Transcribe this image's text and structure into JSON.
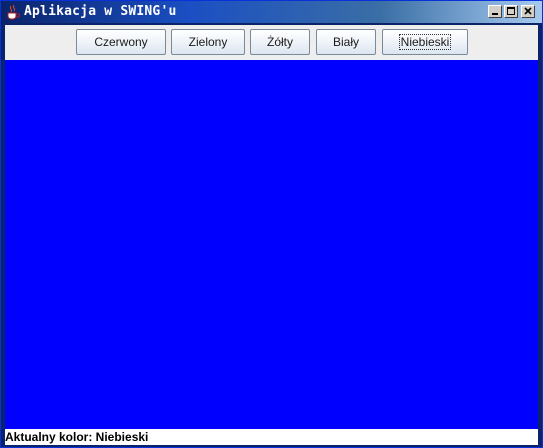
{
  "window": {
    "title": "Aplikacja w SWING'u",
    "icons": {
      "app": "java-coffee-cup-icon",
      "minimize": "minimize-icon",
      "maximize": "maximize-icon",
      "close": "close-icon"
    }
  },
  "toolbar": {
    "buttons": [
      {
        "id": "red",
        "label": "Czerwony"
      },
      {
        "id": "green",
        "label": "Zielony"
      },
      {
        "id": "yellow",
        "label": "Żółty"
      },
      {
        "id": "white",
        "label": "Biały"
      },
      {
        "id": "blue",
        "label": "Niebieski",
        "focused": true
      }
    ]
  },
  "canvas": {
    "color": "#0000ff"
  },
  "status": {
    "text": "Aktualny kolor: Niebieski"
  }
}
